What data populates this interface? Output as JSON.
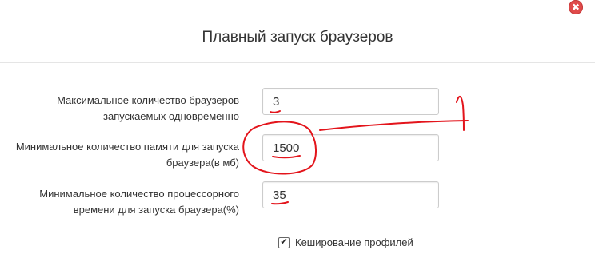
{
  "dialog": {
    "title": "Плавный запуск браузеров",
    "close_icon": "✖"
  },
  "fields": [
    {
      "label_line1": "Максимальное количество браузеров",
      "label_line2": "запускаемых одновременно",
      "value": "3"
    },
    {
      "label_line1": "Минимальное количество памяти для запуска",
      "label_line2": "браузера(в мб)",
      "value": "1500"
    },
    {
      "label_line1": "Минимальное количество процессорного",
      "label_line2": "времени для запуска браузера(%)",
      "value": "35"
    }
  ],
  "checkbox": {
    "label": "Кеширование профилей",
    "checked": true,
    "mark": "✔"
  },
  "annotation_color": "#e3141b"
}
